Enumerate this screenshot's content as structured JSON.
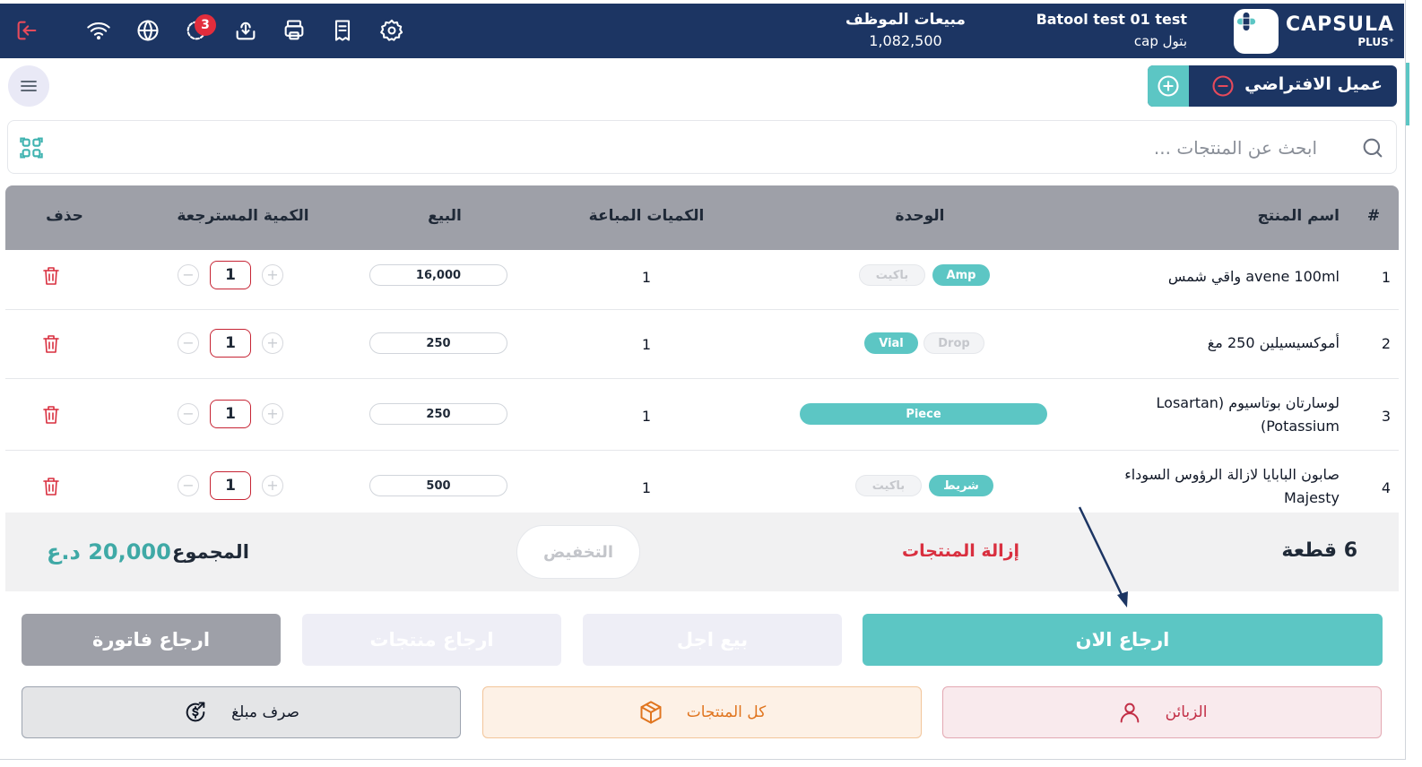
{
  "header": {
    "brand_name": "CAPSULA",
    "brand_sub": "PLUS⁺",
    "user_name": "Batool test 01 test",
    "user_sub": "بتول cap",
    "sales_title": "مبيعات الموظف",
    "sales_value": "1,082,500",
    "sync_badge": "3"
  },
  "customer": {
    "name": "عميل الافتراضي"
  },
  "search": {
    "placeholder": "ابحث عن المنتجات ..."
  },
  "table": {
    "headers": {
      "index": "#",
      "name": "اسم المنتج",
      "unit": "الوحدة",
      "sold_qty": "الكميات المباعة",
      "sale": "البيع",
      "return_qty": "الكمية المسترجعة",
      "delete": "حذف"
    },
    "rows": [
      {
        "index": "1",
        "name": "avene 100ml واقي شمس",
        "unit_active": "Amp",
        "unit_inactive": "باكيت",
        "sold_qty": "1",
        "sale": "16,000",
        "return_qty": "1"
      },
      {
        "index": "2",
        "name": "أموكسيسيلين 250 مغ",
        "unit_active": "Vial",
        "unit_inactive": "Drop",
        "sold_qty": "1",
        "sale": "250",
        "return_qty": "1"
      },
      {
        "index": "3",
        "name": "لوسارتان بوتاسيوم (Losartan Potassium)",
        "unit_active": "Piece",
        "sold_qty": "1",
        "sale": "250",
        "return_qty": "1"
      },
      {
        "index": "4",
        "name": "صابون البابايا لازالة الرؤوس السوداء Majesty",
        "unit_active": "شريط",
        "unit_inactive": "باكيت",
        "sold_qty": "1",
        "sale": "500",
        "return_qty": "1"
      }
    ]
  },
  "summary": {
    "count": "6 قطعة",
    "remove_products": "إزالة المنتجات",
    "discount": "التخفيض",
    "total_label": "المجموع",
    "total_value": "20,000 د.ع"
  },
  "actions": {
    "return_now": "ارجاع الان",
    "sell_later": "بيع اجل",
    "return_products": "ارجاع منتجات",
    "return_invoice": "ارجاع فاتورة"
  },
  "bottom": {
    "customers": "الزبائن",
    "all_products": "كل المنتجات",
    "spend_amount": "صرف مبلغ"
  },
  "colors": {
    "navy": "#1c3563",
    "teal": "#5cc6c4",
    "red": "#d92f3f",
    "gray_header": "#9ea0a8"
  }
}
